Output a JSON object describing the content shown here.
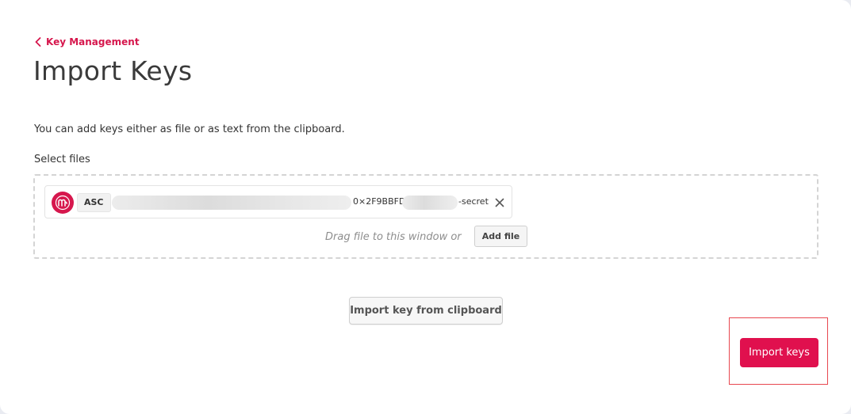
{
  "breadcrumb": {
    "label": "Key Management"
  },
  "page": {
    "title": "Import Keys",
    "intro": "You can add keys either as file or as text from the clipboard.",
    "select_files_label": "Select files"
  },
  "file_chip": {
    "type": "ASC",
    "name_visible_part_1": "0×2F9BBFD",
    "name_visible_part_2": "-secret",
    "logo_icon": "mailvelope-logo-icon",
    "remove_icon": "close-icon"
  },
  "dropzone": {
    "hint": "Drag file to this window or",
    "add_file_label": "Add file"
  },
  "actions": {
    "clipboard_label": "Import key from clipboard",
    "import_label": "Import keys"
  },
  "colors": {
    "accent": "#e0104e",
    "link": "#d6174d",
    "highlight": "#e8474f"
  }
}
